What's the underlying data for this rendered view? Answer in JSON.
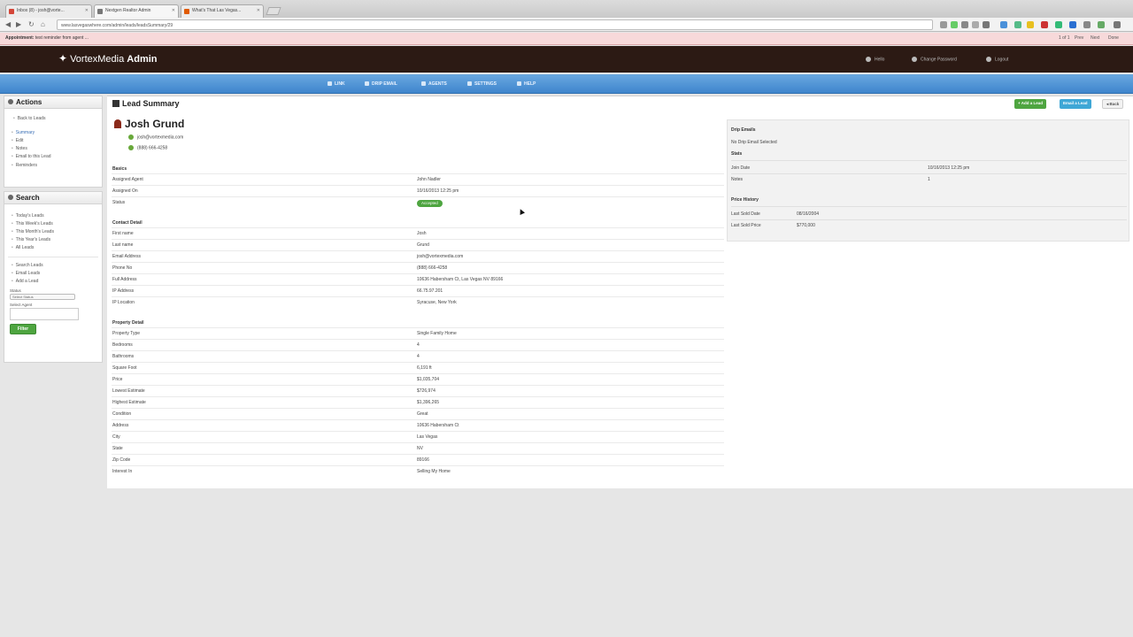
{
  "browser": {
    "tabs": [
      {
        "label": "Inbox (8) - josh@vorte...",
        "active": false,
        "favicon_color": "#d44638"
      },
      {
        "label": "Nextgen Realtor Admin",
        "active": true,
        "favicon_color": "#777777"
      },
      {
        "label": "What's That Las Vegas...",
        "active": false,
        "favicon_color": "#e05a00"
      }
    ],
    "url": "www.lasvegaswhere.com/admin/leads/leadsSummary/29",
    "find_bar": {
      "bold": "Appointment:",
      "text": "test reminder from agent ...",
      "count": "1 of 1",
      "prev": "Prev",
      "next": "Next",
      "done": "Done"
    }
  },
  "header": {
    "brand_light": "VortexMedia",
    "brand_bold": "Admin",
    "user_nav": [
      {
        "label": "Hello",
        "icon": "user-icon"
      },
      {
        "label": "Change Password",
        "icon": "key-icon"
      },
      {
        "label": "Logout",
        "icon": "close-icon"
      }
    ]
  },
  "menu": [
    {
      "label": "LINK",
      "icon": "check-icon"
    },
    {
      "label": "DRIP EMAIL",
      "icon": "mail-icon"
    },
    {
      "label": "AGENTS",
      "icon": "user-icon"
    },
    {
      "label": "SETTINGS",
      "icon": "gear-icon"
    },
    {
      "label": "HELP",
      "icon": "help-icon"
    }
  ],
  "sidebar": {
    "actions_title": "Actions",
    "back_link": "Back to Leads",
    "actions": [
      "Summary",
      "Edit",
      "Notes",
      "Email to this Lead",
      "Reminders"
    ],
    "search_title": "Search",
    "search_links": [
      "Today's Leads",
      "This Week's Leads",
      "This Month's Leads",
      "This Year's Leads",
      "All Leads"
    ],
    "search_links2": [
      "Search Leads",
      "Email Leads",
      "Add a Lead"
    ],
    "status_label": "Status",
    "status_value": "Select Status",
    "agent_label": "Select Agent",
    "filter_button": "Filter"
  },
  "main": {
    "title": "Lead Summary",
    "buttons": [
      {
        "label": "Add a Lead",
        "color": "#4ea540"
      },
      {
        "label": "Email a Lead",
        "color": "#3fa7d6"
      },
      {
        "label": "Back",
        "color": "#f2f2f2"
      }
    ],
    "lead": {
      "name": "Josh Grund",
      "email": "josh@vortexmedia.com",
      "phone": "(888) 666-4258"
    },
    "sections": [
      {
        "title": "Basics",
        "rows": [
          {
            "k": "Assigned Agent",
            "v": "John Nadler"
          },
          {
            "k": "Assigned On",
            "v": "10/16/2013 12:25 pm"
          },
          {
            "k": "Status",
            "v": "Accepted",
            "badge": true
          }
        ]
      },
      {
        "title": "Contact Detail",
        "rows": [
          {
            "k": "First name",
            "v": "Josh"
          },
          {
            "k": "Last name",
            "v": "Grund"
          },
          {
            "k": "Email Address",
            "v": "josh@vortexmedia.com"
          },
          {
            "k": "Phone No",
            "v": "(888) 666-4258"
          },
          {
            "k": "Full Address",
            "v": "10636 Habersham Ct, Las Vegas NV 89166"
          },
          {
            "k": "IP Address",
            "v": "66.75.97.201"
          },
          {
            "k": "IP Location",
            "v": "Syracuse, New York"
          }
        ]
      },
      {
        "title": "Property Detail",
        "rows": [
          {
            "k": "Property Type",
            "v": "Single Family Home"
          },
          {
            "k": "Bedrooms",
            "v": "4"
          },
          {
            "k": "Bathrooms",
            "v": "4"
          },
          {
            "k": "Square Foot",
            "v": "6,191 ft"
          },
          {
            "k": "Price",
            "v": "$1,035,704"
          },
          {
            "k": "Lowest Estimate",
            "v": "$726,974"
          },
          {
            "k": "Highest Estimate",
            "v": "$1,396,265"
          },
          {
            "k": "Condition",
            "v": "Great"
          },
          {
            "k": "Address",
            "v": "10636 Habersham Ct"
          },
          {
            "k": "City",
            "v": "Las Vegas"
          },
          {
            "k": "State",
            "v": "NV"
          },
          {
            "k": "Zip Code",
            "v": "89166"
          },
          {
            "k": "Interest In",
            "v": "Selling My Home"
          }
        ]
      }
    ],
    "right_panel": {
      "drip_title": "Drip Emails",
      "drip_text": "No Drip Email Selected",
      "stats_title": "Stats",
      "stats": [
        {
          "k": "Join Date",
          "v": "10/16/2013 12:25 pm"
        },
        {
          "k": "Notes",
          "v": "1"
        }
      ],
      "price_title": "Price History",
      "price": [
        {
          "k": "Last Sold Date",
          "v": "08/16/2004"
        },
        {
          "k": "Last Sold Price",
          "v": "$770,000"
        }
      ]
    }
  }
}
